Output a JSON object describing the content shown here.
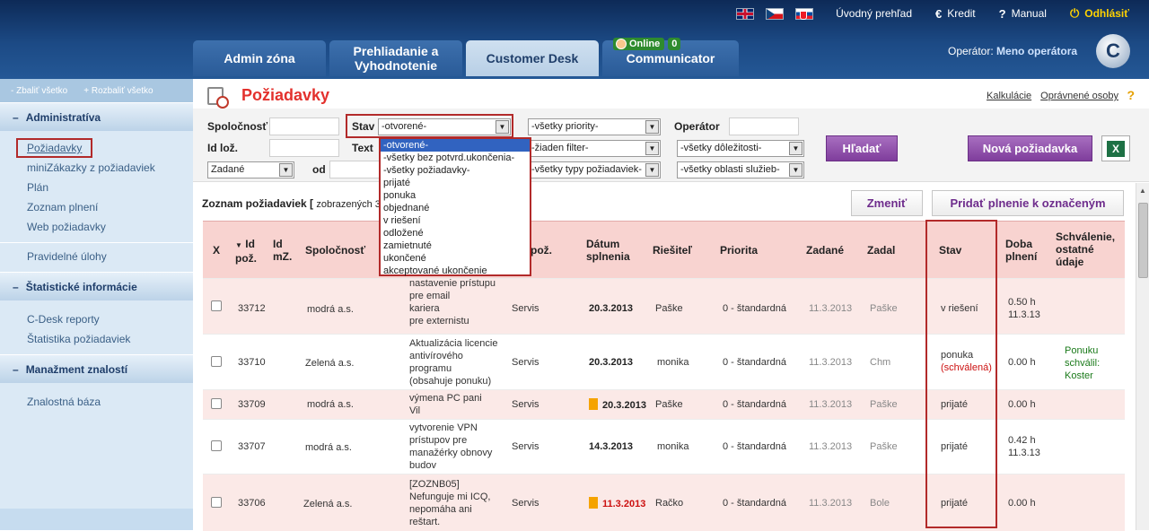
{
  "topbar": {
    "overview": "Úvodný prehľad",
    "credit": "Kredit",
    "manual": "Manual",
    "logout": "Odhlásiť"
  },
  "tabs": [
    "Admin zóna",
    "Prehliadanie a Vyhodnotenie",
    "Customer Desk",
    "Communicator"
  ],
  "online": {
    "label": "Online",
    "count": "0"
  },
  "operator": {
    "label": "Operátor:",
    "name": "Meno operátora"
  },
  "logo": "C",
  "sidebar": {
    "collapse": "Zbaliť všetko",
    "expand": "Rozbaliť všetko",
    "sections": [
      {
        "title": "Administratíva",
        "items": [
          "Požiadavky",
          "miniZákazky z požiadaviek",
          "Plán",
          "Zoznam plnení",
          "Web požiadavky"
        ]
      },
      {
        "title": "",
        "items": [
          "Pravidelné úlohy"
        ]
      },
      {
        "title": "Štatistické informácie",
        "items": [
          "C-Desk reporty",
          "Štatistika požiadaviek"
        ]
      },
      {
        "title": "Manažment znalostí",
        "items": [
          "Znalostná báza"
        ]
      }
    ]
  },
  "page": {
    "title": "Požiadavky",
    "link1": "Kalkulácie",
    "link2": "Oprávnené osoby",
    "help": "?"
  },
  "filter": {
    "company_label": "Spoločnosť",
    "status_label": "Stav",
    "status_value": "-otvorené-",
    "priority_value": "-všetky priority-",
    "operator_label": "Operátor",
    "id_label": "Id lož.",
    "text_label": "Text",
    "filter_value": "-žiaden filter-",
    "importance_value": "-všetky dôležitosti-",
    "assigned_value": "Zadané",
    "from_label": "od",
    "types_value": "-všetky typy požiadaviek-",
    "areas_value": "-všetky oblasti služieb-",
    "search_btn": "Hľadať",
    "new_btn": "Nová požiadavka",
    "xls": "X"
  },
  "dropdown": [
    "-otvorené-",
    "-všetky bez potvrd.ukončenia-",
    "-všetky požiadavky-",
    "prijaté",
    "ponuka",
    "objednané",
    "v riešení",
    "odložené",
    "zamietnuté",
    "ukončené",
    "akceptované ukončenie"
  ],
  "list": {
    "title": "Zoznam požiadaviek [",
    "shown": "zobrazených 3",
    "change_btn": "Zmeniť",
    "add_btn": "Pridať plnenie k označeným"
  },
  "columns": {
    "x": "X",
    "id": "Id pož.",
    "idmz": "Id mZ.",
    "company": "Spoločnosť",
    "req": "pož.",
    "date": "Dátum splnenia",
    "solver": "Riešiteľ",
    "priority": "Priorita",
    "assigned": "Zadané",
    "by": "Zadal",
    "status": "Stav",
    "duration": "Doba plnení",
    "approval": "Schválenie, ostatné údaje"
  },
  "rows": [
    {
      "id": "33712",
      "company": "modrá a.s.",
      "desc": [
        "nastavenie prístupu",
        "pre email",
        "kariera",
        "pre externistu"
      ],
      "note": "",
      "type": "Servis",
      "flag": false,
      "date": "20.3.2013",
      "date_red": false,
      "solver": "Paške",
      "priority": "0 - štandardná",
      "assigned": "11.3.2013",
      "by": "Paške",
      "status": "v riešení",
      "status2": "",
      "duration": [
        "0.50 h",
        "11.3.13"
      ],
      "approval": []
    },
    {
      "id": "33710",
      "company": "Zelená a.s.",
      "desc": [
        "Aktualizácia licencie",
        "antivírového",
        "programu"
      ],
      "note": "(obsahuje ponuku)",
      "type": "Servis",
      "flag": false,
      "date": "20.3.2013",
      "date_red": false,
      "solver": "monika",
      "priority": "0 - štandardná",
      "assigned": "11.3.2013",
      "by": "Chm",
      "status": "ponuka",
      "status2": "(schválená)",
      "duration": [
        "0.00 h"
      ],
      "approval": [
        "Ponuku",
        "schválil:",
        "Koster"
      ]
    },
    {
      "id": "33709",
      "company": "modrá a.s.",
      "desc": [
        "výmena PC pani",
        "Vil"
      ],
      "note": "",
      "type": "Servis",
      "flag": true,
      "date": "20.3.2013",
      "date_red": false,
      "solver": "Paške",
      "priority": "0 - štandardná",
      "assigned": "11.3.2013",
      "by": "Paške",
      "status": "prijaté",
      "status2": "",
      "duration": [
        "0.00 h"
      ],
      "approval": []
    },
    {
      "id": "33707",
      "company": "modrá a.s.",
      "desc": [
        "vytvorenie VPN",
        "prístupov pre",
        "manažérky obnovy",
        "budov"
      ],
      "note": "",
      "type": "Servis",
      "flag": false,
      "date": "14.3.2013",
      "date_red": false,
      "solver": "monika",
      "priority": "0 - štandardná",
      "assigned": "11.3.2013",
      "by": "Paške",
      "status": "prijaté",
      "status2": "",
      "duration": [
        "0.42 h",
        "11.3.13"
      ],
      "approval": []
    },
    {
      "id": "33706",
      "company": "Zelená a.s.",
      "desc": [
        "[ZOZNB05]",
        "Nefunguje mi ICQ,",
        "nepomáha ani",
        "reštart."
      ],
      "note": "",
      "type": "Servis",
      "flag": true,
      "date": "11.3.2013",
      "date_red": true,
      "solver": "Račko",
      "priority": "0 - štandardná",
      "assigned": "11.3.2013",
      "by": "Bole",
      "status": "prijaté",
      "status2": "",
      "duration": [
        "0.00 h"
      ],
      "approval": []
    }
  ]
}
